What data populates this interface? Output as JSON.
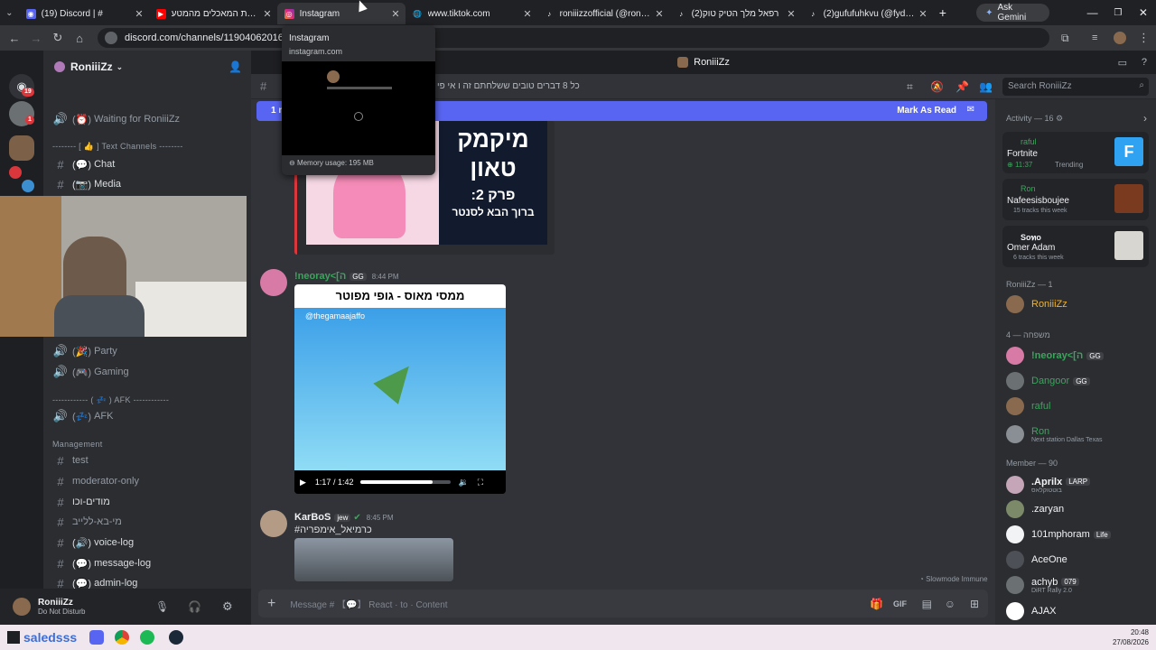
{
  "browser": {
    "tabs": [
      {
        "title": "(19) Discord | #",
        "icon": "discord-icon",
        "color": "#5865f2"
      },
      {
        "title": "אוכל את המאכלים מהמטע",
        "icon": "youtube-icon",
        "color": "#ff0000"
      },
      {
        "title": "Instagram",
        "icon": "instagram-icon",
        "color": "#d6249f"
      },
      {
        "title": "www.tiktok.com",
        "icon": "globe-icon",
        "color": "#9aa0a6"
      },
      {
        "title": "roniiizzofficial (@roniiizzoffi",
        "icon": "tiktok-icon",
        "color": "#ffffff"
      },
      {
        "title": "(2)רפאל מלך הטיק טוק",
        "icon": "tiktok-icon",
        "color": "#ffffff"
      },
      {
        "title": "(2)gufufuhkvu (@fydyfugu",
        "icon": "tiktok-icon",
        "color": "#ffffff"
      }
    ],
    "new_tab": "+",
    "gemini_label": "Ask Gemini",
    "url": "discord.com/channels/119040620163735​14",
    "tooltip": {
      "title": "Instagram",
      "domain": "instagram.com",
      "memory": "Memory usage: 195 MB"
    }
  },
  "discord": {
    "window_title": "RoniiiZz",
    "server_name": "RoniiiZz",
    "badges": {
      "notif": "19",
      "dm": "1"
    },
    "channels": [
      {
        "icon": "speaker-icon",
        "label": "Waiting for RoniiiZz",
        "emoji": "⏰",
        "type": "voice"
      },
      {
        "type": "category",
        "label": "-------- [ 👍 ] Text Channels --------"
      },
      {
        "icon": "hash-icon",
        "label": "Chat",
        "emoji": "💬",
        "type": "text"
      },
      {
        "icon": "hash-icon",
        "label": "Media",
        "emoji": "📷",
        "type": "text"
      },
      {
        "icon": "speaker-icon",
        "label": "Party",
        "emoji": "🎉",
        "type": "voice"
      },
      {
        "icon": "speaker-icon",
        "label": "Gaming",
        "emoji": "🎮",
        "type": "voice"
      },
      {
        "type": "category",
        "label": "------------ ( 💤 ) AFK ------------"
      },
      {
        "icon": "speaker-icon",
        "label": "AFK",
        "emoji": "💤",
        "type": "voice"
      },
      {
        "type": "category",
        "label": "Management"
      },
      {
        "icon": "hash-icon",
        "label": "test",
        "type": "text"
      },
      {
        "icon": "hash-icon",
        "label": "moderator-only",
        "type": "text"
      },
      {
        "icon": "hash-icon",
        "label": "מודים-וכו",
        "type": "text",
        "bright": true
      },
      {
        "icon": "hash-icon",
        "label": "מי-בא-ללייב",
        "type": "text"
      },
      {
        "icon": "hash-icon",
        "label": "voice-log",
        "emoji": "🔊",
        "type": "text",
        "bright": true
      },
      {
        "icon": "hash-icon",
        "label": "message-log",
        "emoji": "💬",
        "type": "text",
        "bright": true
      },
      {
        "icon": "hash-icon",
        "label": "admin-log",
        "emoji": "💬",
        "type": "text",
        "bright": true
      }
    ],
    "channel_topic": "כל 8 דברים טובים ששלחתם זה ו אי פי",
    "unread_bar": {
      "left": "1 ne",
      "action": "Mark As Read"
    },
    "search_placeholder": "Search RoniiiZz",
    "messages": [
      {
        "thumb_title": "מיקמק טאון",
        "thumb_sub": "פרק 2:",
        "thumb_sub2": "ברוך הבא לסנטר"
      },
      {
        "author": "!neoray<[ה",
        "tag": "GG",
        "time": "8:44 PM",
        "video_title": "ממסי מאוס - גופי מפוטר",
        "video_handle": "@thegamaajaffo",
        "video_time": "1:17 / 1:42"
      },
      {
        "author": "KarBoS",
        "tag": "jew",
        "time": "8:45 PM",
        "text": "#כרמיאל_אימפריה"
      }
    ],
    "slowmode": "Slowmode Immune",
    "composer_placeholder": "Message # 【💬】 React · to · Content",
    "user": {
      "name": "RoniiiZz",
      "status": "Do Not Disturb"
    },
    "activity": {
      "header": "Activity — 16",
      "cards": [
        {
          "user": "raful",
          "title": "Fortnite",
          "meta_time": "11:37",
          "meta": "Trending",
          "thumb": "F"
        },
        {
          "user": "Ron",
          "title": "Nafeesisboujee",
          "meta": "15 tracks this week"
        },
        {
          "user": "Soทo",
          "title": "Omer Adam",
          "meta": "6 tracks this week"
        }
      ]
    },
    "member_groups": [
      {
        "header": "RoniiiZz — 1",
        "members": [
          {
            "name": "RoniiiZz",
            "color": "#f0b232"
          }
        ]
      },
      {
        "header": "משפחה — 4",
        "members": [
          {
            "name": "!neoray<[ה",
            "color": "#3ba55c",
            "tag": "GG"
          },
          {
            "name": "Dangoor",
            "color": "#3ba55c",
            "tag": "GG"
          },
          {
            "name": "raful",
            "color": "#3ba55c"
          },
          {
            "name": "Ron",
            "color": "#3ba55c",
            "sub": "Next station Dallas Texas"
          }
        ]
      },
      {
        "header": "Member — 90",
        "members": [
          {
            "name": ".Aprilx",
            "color": "#f2f3f5",
            "tag": "LARP",
            "sub": "בוטטוקלאס"
          },
          {
            "name": ".zaryan",
            "color": "#f2f3f5"
          },
          {
            "name": "101mphoram",
            "color": "#f2f3f5",
            "tag": "Life"
          },
          {
            "name": "AceOne",
            "color": "#f2f3f5"
          },
          {
            "name": "achyb",
            "color": "#f2f3f5",
            "tag": "079",
            "sub": "DiRT Rally 2.0"
          },
          {
            "name": "AJAX",
            "color": "#f2f3f5"
          }
        ]
      }
    ]
  },
  "taskbar": {
    "search": "saledsss",
    "time": "20:48",
    "date": "27/08/2026"
  }
}
